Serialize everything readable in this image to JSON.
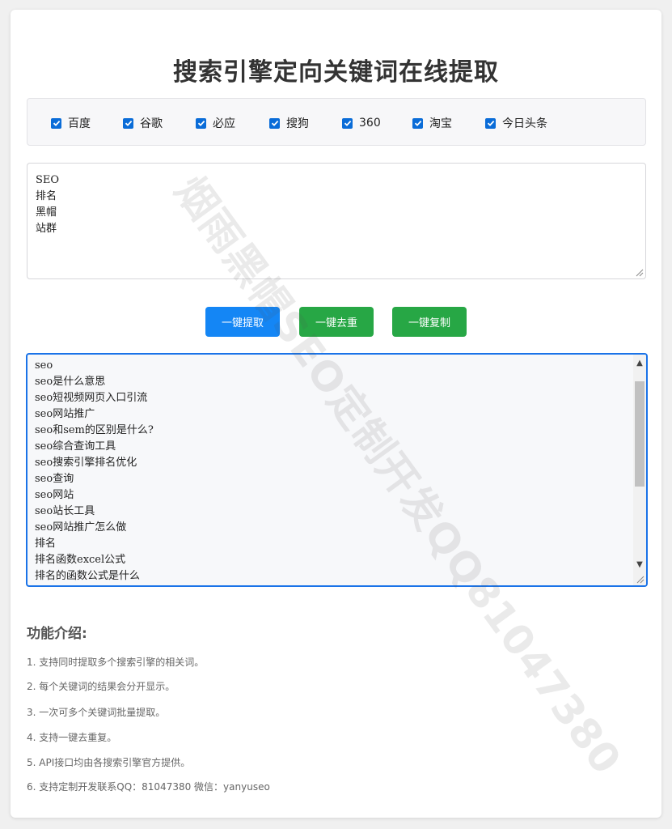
{
  "page": {
    "title": "搜索引擎定向关键词在线提取",
    "watermark": "烟雨黑帽SEO定制开发QQ81047380"
  },
  "engines": [
    {
      "label": "百度",
      "checked": true
    },
    {
      "label": "谷歌",
      "checked": true
    },
    {
      "label": "必应",
      "checked": true
    },
    {
      "label": "搜狗",
      "checked": true
    },
    {
      "label": "360",
      "checked": true
    },
    {
      "label": "淘宝",
      "checked": true
    },
    {
      "label": "今日头条",
      "checked": true
    }
  ],
  "keywords_input": {
    "lines": [
      "SEO",
      "排名",
      "黑帽",
      "站群"
    ]
  },
  "buttons": {
    "extract": "一键提取",
    "dedupe": "一键去重",
    "copy": "一键复制"
  },
  "results": {
    "lines": [
      "seo",
      "seo是什么意思",
      "seo短视频网页入口引流",
      "seo网站推广",
      "seo和sem的区别是什么?",
      "seo综合查询工具",
      "seo搜索引擎排名优化",
      "seo查询",
      "seo网站",
      "seo站长工具",
      "seo网站推广怎么做",
      "排名",
      "排名函数excel公式",
      "排名的函数公式是什么"
    ]
  },
  "features": {
    "title": "功能介绍:",
    "items": [
      "1. 支持同时提取多个搜索引擎的相关词。",
      "2. 每个关键词的结果会分开显示。",
      "3. 一次可多个关键词批量提取。",
      "4. 支持一键去重复。",
      "5. API接口均由各搜索引擎官方提供。",
      "6. 支持定制开发联系QQ：81047380 微信：yanyuseo"
    ]
  },
  "colors": {
    "primary_blue": "#1486f5",
    "green": "#27a745",
    "checkbox_blue": "#0a6cd8",
    "focus_border": "#1a73e8"
  }
}
